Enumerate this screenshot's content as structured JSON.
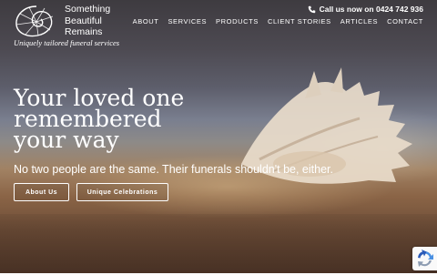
{
  "brand": {
    "name_lines": [
      "Something",
      "Beautiful",
      "Remains"
    ],
    "tagline": "Uniquely tailored funeral services"
  },
  "header": {
    "call_text": "Call us now on 0424 742 936",
    "nav": [
      "ABOUT",
      "SERVICES",
      "PRODUCTS",
      "CLIENT STORIES",
      "ARTICLES",
      "CONTACT"
    ]
  },
  "hero": {
    "headline_lines": [
      "Your loved one",
      "remembered",
      "your way"
    ],
    "subheading": "No two people are the same. Their funerals shouldn't be, either.",
    "buttons": [
      "About Us",
      "Unique Celebrations"
    ]
  },
  "icons": {
    "logo": "nautilus-shell-logo",
    "phone": "phone-icon",
    "recaptcha": "recaptcha-icon"
  },
  "colors": {
    "text": "#ffffff",
    "recaptcha_blue": "#4a90e2"
  }
}
